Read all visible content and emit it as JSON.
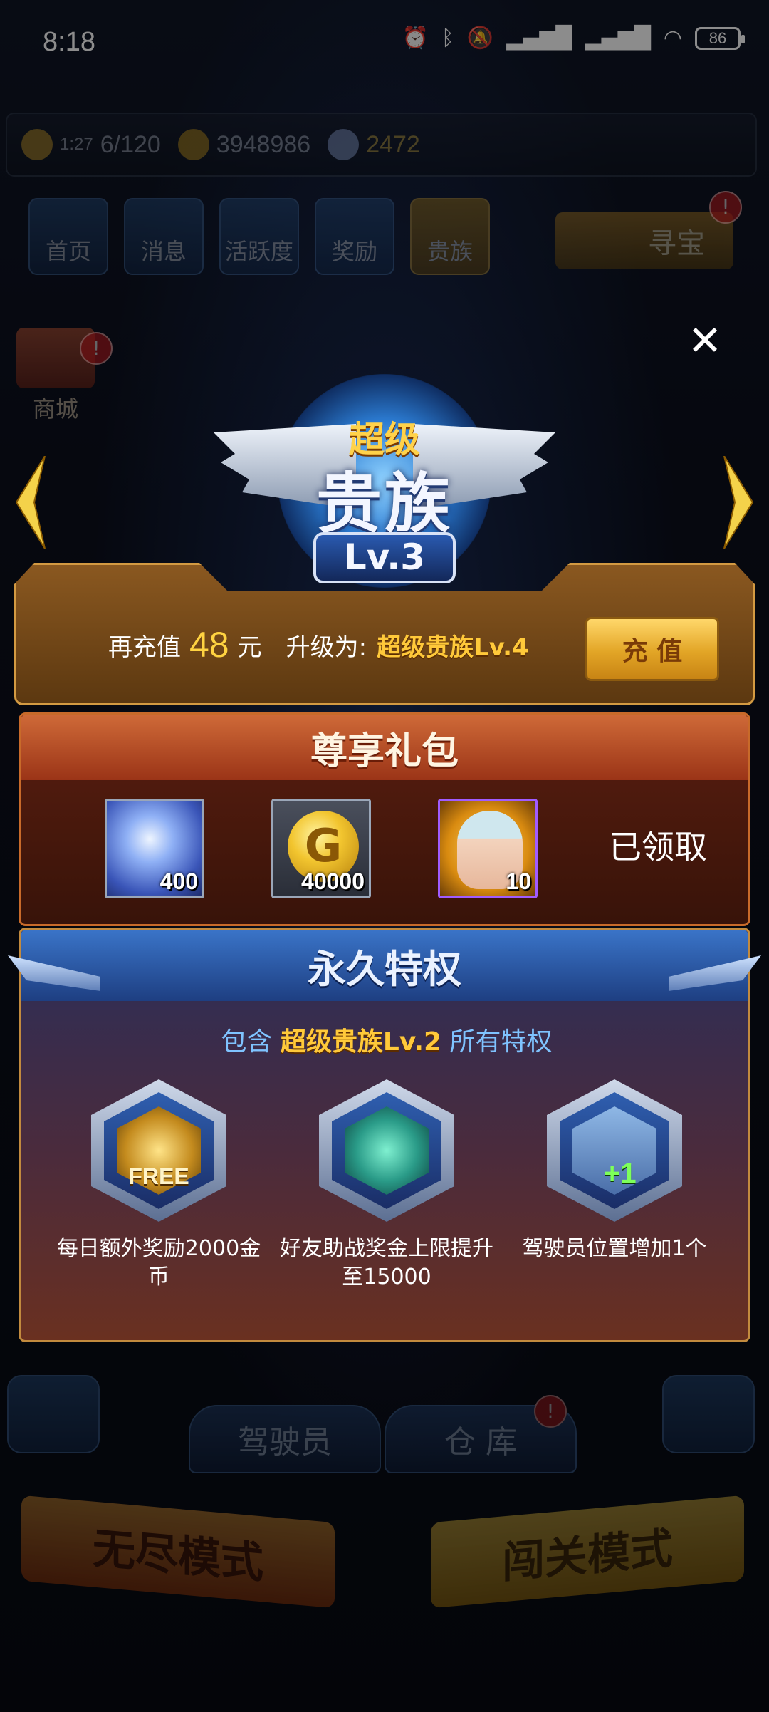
{
  "status_bar": {
    "time": "8:18",
    "battery": "86",
    "icons": [
      "alarm-icon",
      "bluetooth-icon",
      "mute-icon",
      "5g-signal-icon",
      "4g-signal-icon",
      "wifi-icon",
      "battery-icon"
    ]
  },
  "resources": {
    "energy_timer": "1:27",
    "energy": "6/120",
    "gold": "3948986",
    "diamonds": "2472"
  },
  "top_nav": {
    "items": [
      {
        "label": "首页"
      },
      {
        "label": "消息"
      },
      {
        "label": "活跃度"
      },
      {
        "label": "奖励"
      },
      {
        "label": "贵族"
      }
    ],
    "treasure_label": "寻宝",
    "treasure_badge": "!",
    "shop_label": "商城",
    "shop_badge": "!"
  },
  "dialog": {
    "badge": {
      "super": "超级",
      "title": "贵族",
      "level": "Lv.3"
    },
    "upgrade": {
      "prefix": "再充值",
      "amount": "48",
      "unit": "元",
      "upgrade_to": "升级为:",
      "next_level": "超级贵族Lv.4",
      "recharge_button": "充 值"
    },
    "gift": {
      "title": "尊享礼包",
      "items": [
        {
          "name": "diamond",
          "qty": "400"
        },
        {
          "name": "gold-coin",
          "qty": "40000"
        },
        {
          "name": "pilot-card",
          "qty": "10"
        }
      ],
      "status": "已领取"
    },
    "privileges": {
      "title": "永久特权",
      "sub_prefix": "包含",
      "sub_highlight": "超级贵族Lv.2",
      "sub_suffix": "所有特权",
      "free_text": "FREE",
      "plus_text": "+1",
      "items": [
        {
          "label": "每日额外奖励2000金币"
        },
        {
          "label": "好友助战奖金上限提升至15000"
        },
        {
          "label": "驾驶员位置增加1个"
        }
      ]
    }
  },
  "bottom": {
    "pilot_label": "驾驶员",
    "warehouse_label": "仓 库",
    "warehouse_badge": "!",
    "endless_mode": "无尽模式",
    "stage_mode": "闯关模式"
  },
  "colors": {
    "gold_accent": "#ffd341",
    "privilege_blue": "#7fc3ff",
    "gift_red": "#9b3417"
  }
}
